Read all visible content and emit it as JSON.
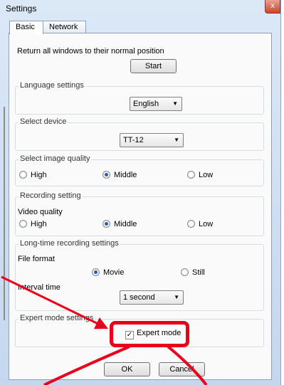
{
  "window": {
    "title": "Settings",
    "close_symbol": "x"
  },
  "tabs": [
    {
      "label": "Basic"
    },
    {
      "label": "Network"
    }
  ],
  "general": {
    "return_label": "Return all windows to their normal position",
    "start_button": "Start"
  },
  "language": {
    "title": "Language settings",
    "selected": "English"
  },
  "device": {
    "title": "Select device",
    "selected": "TT-12"
  },
  "image_quality": {
    "title": "Select image quality",
    "options": [
      "High",
      "Middle",
      "Low"
    ],
    "selected": "Middle"
  },
  "recording": {
    "title": "Recording setting",
    "video_quality_label": "Video quality",
    "options": [
      "High",
      "Middle",
      "Low"
    ],
    "selected": "Middle"
  },
  "long_time": {
    "title": "Long-time recording settings",
    "file_format_label": "File format",
    "file_format_options": [
      "Movie",
      "Still"
    ],
    "file_format_selected": "Movie",
    "interval_label": "Interval time",
    "interval_selected": "1 second"
  },
  "expert": {
    "title": "Expert mode settings",
    "checkbox_label": "Expert mode",
    "checked": true,
    "check_mark": "✓"
  },
  "footer": {
    "ok_button": "OK",
    "cancel_button": "Cancel"
  },
  "annotation_color": "#e8001c"
}
